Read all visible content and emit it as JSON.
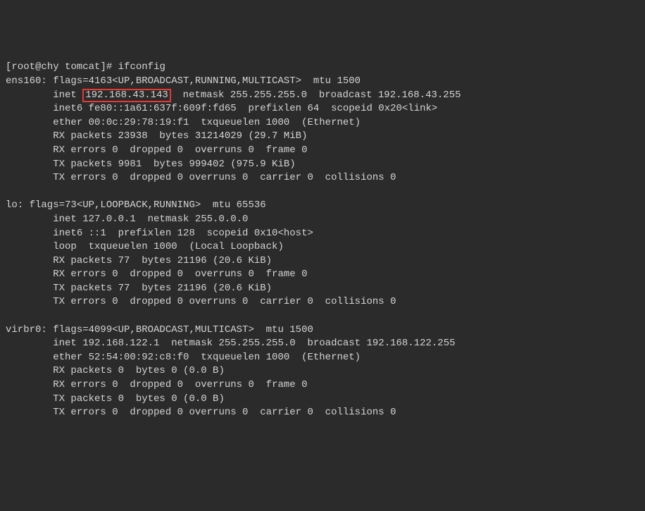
{
  "prompt": {
    "open": "[",
    "user": "root",
    "at": "@",
    "host": "chy",
    "dir": " tomcat",
    "close": "]# ",
    "command": "ifconfig"
  },
  "highlighted_ip": "192.168.43.143",
  "interfaces": {
    "ens160": {
      "header": "ens160: flags=4163<UP,BROADCAST,RUNNING,MULTICAST>  mtu 1500",
      "inet_pre": "        inet ",
      "inet_post": "  netmask 255.255.255.0  broadcast 192.168.43.255",
      "inet6": "        inet6 fe80::1a61:637f:609f:fd65  prefixlen 64  scopeid 0x20<link>",
      "ether": "        ether 00:0c:29:78:19:f1  txqueuelen 1000  (Ethernet)",
      "rx_packets": "        RX packets 23938  bytes 31214029 (29.7 MiB)",
      "rx_errors": "        RX errors 0  dropped 0  overruns 0  frame 0",
      "tx_packets": "        TX packets 9981  bytes 999402 (975.9 KiB)",
      "tx_errors": "        TX errors 0  dropped 0 overruns 0  carrier 0  collisions 0"
    },
    "lo": {
      "header": "lo: flags=73<UP,LOOPBACK,RUNNING>  mtu 65536",
      "inet": "        inet 127.0.0.1  netmask 255.0.0.0",
      "inet6": "        inet6 ::1  prefixlen 128  scopeid 0x10<host>",
      "loop": "        loop  txqueuelen 1000  (Local Loopback)",
      "rx_packets": "        RX packets 77  bytes 21196 (20.6 KiB)",
      "rx_errors": "        RX errors 0  dropped 0  overruns 0  frame 0",
      "tx_packets": "        TX packets 77  bytes 21196 (20.6 KiB)",
      "tx_errors": "        TX errors 0  dropped 0 overruns 0  carrier 0  collisions 0"
    },
    "virbr0": {
      "header": "virbr0: flags=4099<UP,BROADCAST,MULTICAST>  mtu 1500",
      "inet": "        inet 192.168.122.1  netmask 255.255.255.0  broadcast 192.168.122.255",
      "ether": "        ether 52:54:00:92:c8:f0  txqueuelen 1000  (Ethernet)",
      "rx_packets": "        RX packets 0  bytes 0 (0.0 B)",
      "rx_errors": "        RX errors 0  dropped 0  overruns 0  frame 0",
      "tx_packets": "        TX packets 0  bytes 0 (0.0 B)",
      "tx_errors": "        TX errors 0  dropped 0 overruns 0  carrier 0  collisions 0"
    }
  }
}
